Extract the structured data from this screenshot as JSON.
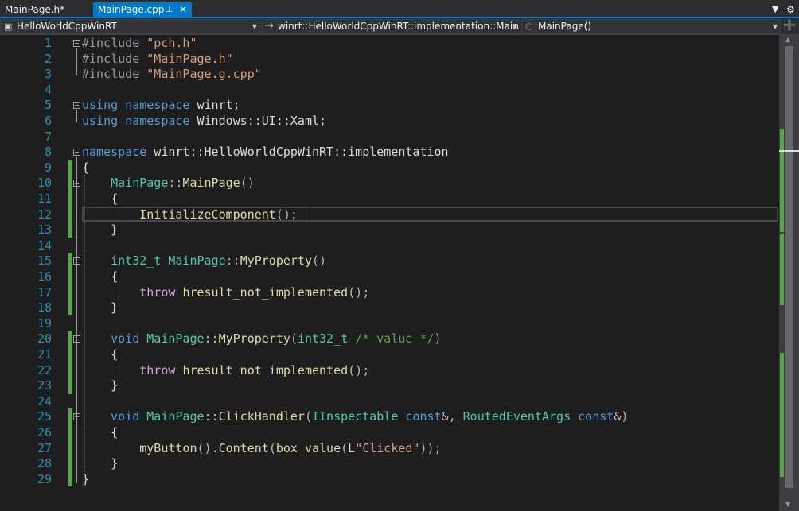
{
  "tabs": [
    {
      "label": "MainPage.h*",
      "active": false
    },
    {
      "label": "MainPage.cpp",
      "active": true
    }
  ],
  "tab_icons": {
    "pin": "pin-icon",
    "close": "close-icon",
    "overflow": "dropdown-icon",
    "settings": "gear-icon"
  },
  "navbar": {
    "project": "HelloWorldCppWinRT",
    "scope": "winrt::HelloWorldCppWinRT::implementation::MainPage",
    "member": "MainPage()"
  },
  "colors": {
    "accent": "#007acc",
    "keyword": "#569cd6",
    "string": "#d69d85",
    "preprocessor": "#9b9b9b",
    "type": "#4ec9b0",
    "function": "#dcdcaa",
    "comment": "#57a64a",
    "control_keyword": "#d8a0df",
    "line_number": "#2b91af",
    "change_marker": "#57a64a"
  },
  "editor": {
    "current_line": 12,
    "lines": [
      {
        "n": "1",
        "segs": [
          [
            "p",
            "#include "
          ],
          [
            "s",
            "\"pch.h\""
          ]
        ]
      },
      {
        "n": "2",
        "segs": [
          [
            "p",
            "#include "
          ],
          [
            "s",
            "\"MainPage.h\""
          ]
        ]
      },
      {
        "n": "3",
        "segs": [
          [
            "p",
            "#include "
          ],
          [
            "s",
            "\"MainPage.g.cpp\""
          ]
        ]
      },
      {
        "n": "4",
        "segs": []
      },
      {
        "n": "5",
        "segs": [
          [
            "k",
            "using"
          ],
          [
            "",
            ""
          ],
          [
            "",
            ""
          ],
          [
            "",
            " "
          ],
          [
            "k",
            "namespace"
          ],
          [
            "",
            " winrt;"
          ]
        ]
      },
      {
        "n": "6",
        "segs": [
          [
            "k",
            "using"
          ],
          [
            "",
            " "
          ],
          [
            "k",
            "namespace"
          ],
          [
            "",
            " Windows::UI::Xaml;"
          ]
        ]
      },
      {
        "n": "7",
        "segs": []
      },
      {
        "n": "8",
        "segs": [
          [
            "k",
            "namespace"
          ],
          [
            "",
            " winrt::HelloWorldCppWinRT::implementation"
          ]
        ]
      },
      {
        "n": "9",
        "segs": [
          [
            "",
            "{"
          ]
        ]
      },
      {
        "n": "10",
        "segs": [
          [
            "",
            "    "
          ],
          [
            "t",
            "MainPage"
          ],
          [
            "g",
            "::"
          ],
          [
            "f",
            "MainPage"
          ],
          [
            "g",
            "()"
          ]
        ]
      },
      {
        "n": "11",
        "segs": [
          [
            "",
            "    {"
          ]
        ]
      },
      {
        "n": "12",
        "segs": [
          [
            "",
            "        "
          ],
          [
            "f",
            "InitializeComponent"
          ],
          [
            "g",
            "();"
          ]
        ]
      },
      {
        "n": "13",
        "segs": [
          [
            "",
            "    }"
          ]
        ]
      },
      {
        "n": "14",
        "segs": []
      },
      {
        "n": "15",
        "segs": [
          [
            "",
            "    "
          ],
          [
            "t",
            "int32_t"
          ],
          [
            "",
            " "
          ],
          [
            "t",
            "MainPage"
          ],
          [
            "g",
            "::"
          ],
          [
            "f",
            "MyProperty"
          ],
          [
            "g",
            "()"
          ]
        ]
      },
      {
        "n": "16",
        "segs": [
          [
            "",
            "    {"
          ]
        ]
      },
      {
        "n": "17",
        "segs": [
          [
            "",
            "        "
          ],
          [
            "kc",
            "throw"
          ],
          [
            "",
            " "
          ],
          [
            "f",
            "hresult_not_implemented"
          ],
          [
            "g",
            "();"
          ]
        ]
      },
      {
        "n": "18",
        "segs": [
          [
            "",
            "    }"
          ]
        ]
      },
      {
        "n": "19",
        "segs": []
      },
      {
        "n": "20",
        "segs": [
          [
            "",
            "    "
          ],
          [
            "k",
            "void"
          ],
          [
            "",
            " "
          ],
          [
            "t",
            "MainPage"
          ],
          [
            "g",
            "::"
          ],
          [
            "f",
            "MyProperty"
          ],
          [
            "g",
            "("
          ],
          [
            "t",
            "int32_t"
          ],
          [
            "",
            " "
          ],
          [
            "c",
            "/* value */"
          ],
          [
            "g",
            ")"
          ]
        ]
      },
      {
        "n": "21",
        "segs": [
          [
            "",
            "    {"
          ]
        ]
      },
      {
        "n": "22",
        "segs": [
          [
            "",
            "        "
          ],
          [
            "kc",
            "throw"
          ],
          [
            "",
            " "
          ],
          [
            "f",
            "hresult_not_implemented"
          ],
          [
            "g",
            "();"
          ]
        ]
      },
      {
        "n": "23",
        "segs": [
          [
            "",
            "    }"
          ]
        ]
      },
      {
        "n": "24",
        "segs": []
      },
      {
        "n": "25",
        "segs": [
          [
            "",
            "    "
          ],
          [
            "k",
            "void"
          ],
          [
            "",
            " "
          ],
          [
            "t",
            "MainPage"
          ],
          [
            "g",
            "::"
          ],
          [
            "f",
            "ClickHandler"
          ],
          [
            "g",
            "("
          ],
          [
            "t",
            "IInspectable"
          ],
          [
            "",
            " "
          ],
          [
            "k",
            "const"
          ],
          [
            "g",
            "&, "
          ],
          [
            "t",
            "RoutedEventArgs"
          ],
          [
            "",
            " "
          ],
          [
            "k",
            "const"
          ],
          [
            "g",
            "&)"
          ]
        ]
      },
      {
        "n": "26",
        "segs": [
          [
            "",
            "    {"
          ]
        ]
      },
      {
        "n": "27",
        "segs": [
          [
            "",
            "        "
          ],
          [
            "f",
            "myButton"
          ],
          [
            "g",
            "()."
          ],
          [
            "f",
            "Content"
          ],
          [
            "g",
            "("
          ],
          [
            "f",
            "box_value"
          ],
          [
            "g",
            "("
          ],
          [
            "",
            "L"
          ],
          [
            "s",
            "\"Clicked\""
          ],
          [
            "g",
            "));"
          ]
        ]
      },
      {
        "n": "28",
        "segs": [
          [
            "",
            "    }"
          ]
        ]
      },
      {
        "n": "29",
        "segs": [
          [
            "",
            "}"
          ]
        ]
      }
    ]
  }
}
